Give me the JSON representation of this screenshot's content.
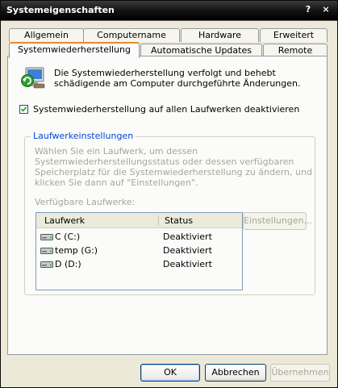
{
  "window": {
    "title": "Systemeigenschaften",
    "help_button": "?",
    "close_button": "×"
  },
  "tabs": {
    "back_row": [
      "Allgemein",
      "Computername",
      "Hardware",
      "Erweitert"
    ],
    "front_row": [
      "Systemwiederherstellung",
      "Automatische Updates",
      "Remote"
    ],
    "active": "Systemwiederherstellung"
  },
  "panel": {
    "intro_text": "Die Systemwiederherstellung verfolgt und behebt schädigende am Computer durchgeführte Änderungen.",
    "disable_all_checkbox": {
      "label": "Systemwiederherstellung auf allen Laufwerken deaktivieren",
      "checked": true
    },
    "drive_settings_group": {
      "title": "Laufwerkeinstellungen",
      "description": "Wählen Sie ein Laufwerk, um dessen Systemwiederherstellungsstatus oder dessen verfügbaren Speicherplatz für die Systemwiederherstellung zu ändern, und klicken Sie dann auf \"Einstellungen\".",
      "available_label": "Verfügbare Laufwerke:",
      "columns": [
        "Laufwerk",
        "Status"
      ],
      "drives": [
        {
          "name": "C (C:)",
          "status": "Deaktiviert"
        },
        {
          "name": "temp (G:)",
          "status": "Deaktiviert"
        },
        {
          "name": "D (D:)",
          "status": "Deaktiviert"
        }
      ],
      "settings_button": "Einstellungen..."
    }
  },
  "footer": {
    "ok": "OK",
    "cancel": "Abbrechen",
    "apply": "Übernehmen"
  }
}
